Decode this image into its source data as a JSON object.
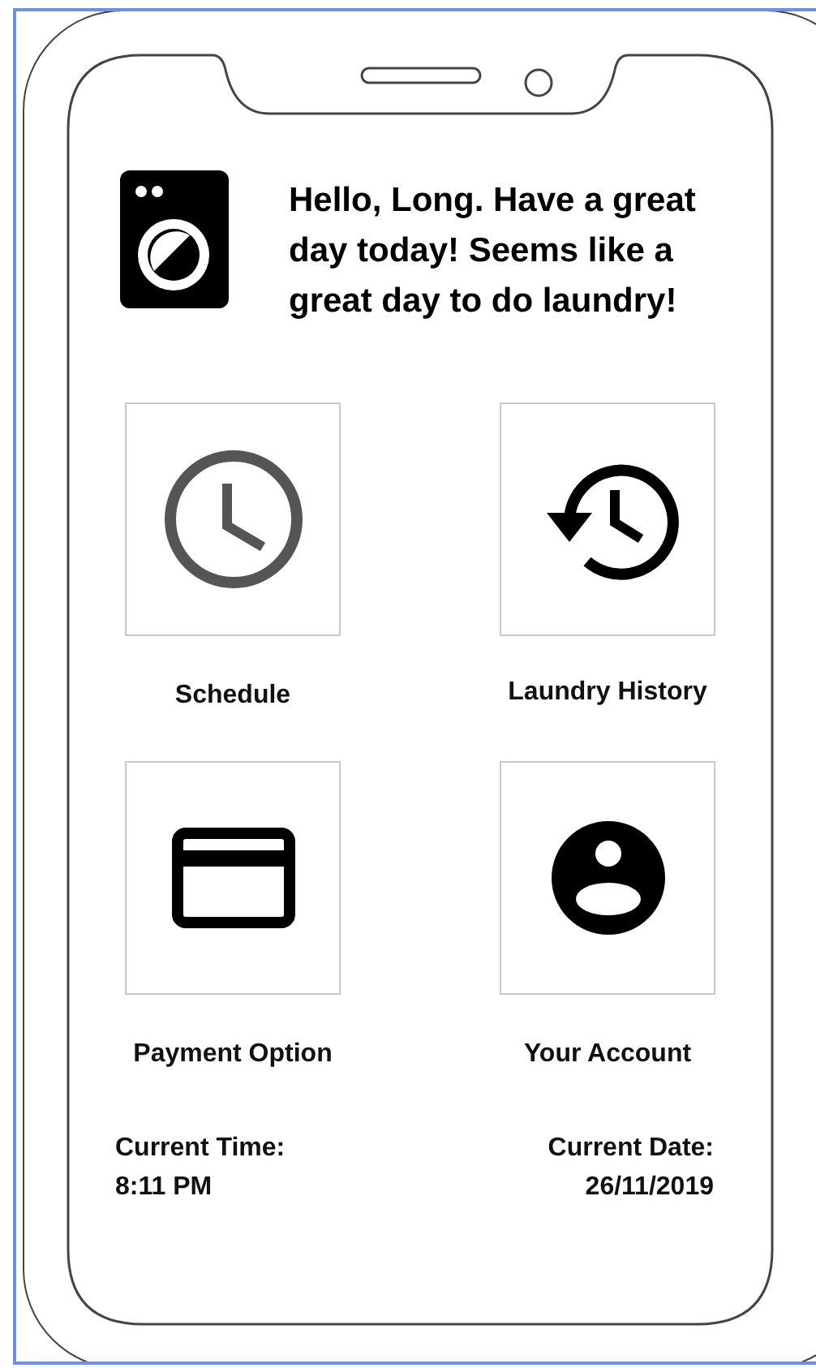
{
  "greeting": "Hello, Long. Have a great day today! Seems like a great day to do laundry!",
  "tiles": [
    {
      "kind": "schedule",
      "label": "Schedule"
    },
    {
      "kind": "history",
      "label": "Laundry History"
    },
    {
      "kind": "payment",
      "label": "Payment Option"
    },
    {
      "kind": "account",
      "label": "Your Account"
    }
  ],
  "time": {
    "label": "Current Time:",
    "value": "8:11 PM"
  },
  "date": {
    "label": "Current Date:",
    "value": "26/11/2019"
  }
}
